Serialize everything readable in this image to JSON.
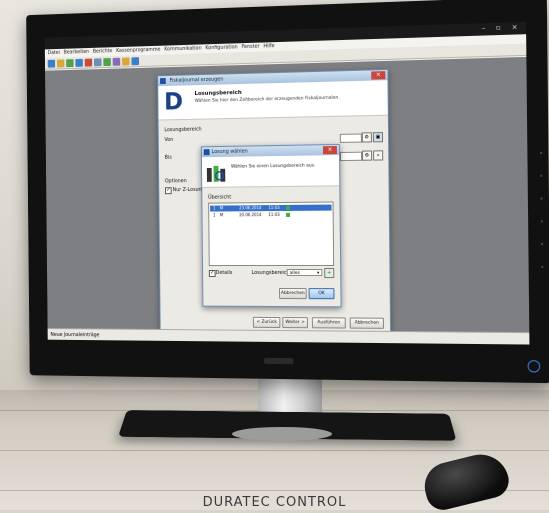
{
  "app": {
    "window_controls": "– ▫ ×",
    "menu": [
      "Datei",
      "Bearbeiten",
      "Berichte",
      "Kassenprogramme",
      "Kommunikation",
      "Konfiguration",
      "Fenster",
      "Hilfe"
    ],
    "statusbar": "Neue Journaleinträge"
  },
  "wizard": {
    "title": "Fiskaljournal erzeugen",
    "logo_letter": "D",
    "heading": "Losungsbereich",
    "subheading": "Wählen Sie hier den Zeitbereich der erzeugenden Fiskaljournalen.",
    "group_label": "Losungsbereich",
    "von_label": "Von",
    "bis_label": "Bis",
    "optionen_label": "Optionen",
    "checkbox_label": "Nur Z-Losungen",
    "buttons": {
      "back": "< Zurück",
      "next": "Weiter >",
      "run": "Ausführen",
      "cancel": "Abbrechen"
    }
  },
  "inner_dialog": {
    "title": "Losung wählen",
    "instruction": "Wählen Sie einen Losungsbereich aus.",
    "list_label": "Übersicht",
    "rows": [
      {
        "col1": "1",
        "col2": "M",
        "date": "23.06.2014",
        "time": "11:03",
        "selected": true
      },
      {
        "col1": "1",
        "col2": "M",
        "date": "20.06.2014",
        "time": "11:03",
        "selected": false
      }
    ],
    "details_label": "Details",
    "range_label": "Losungsbereich",
    "range_value": "alles",
    "cancel": "Abbrechen",
    "ok": "OK"
  },
  "caption": "DURATEC CONTROL"
}
